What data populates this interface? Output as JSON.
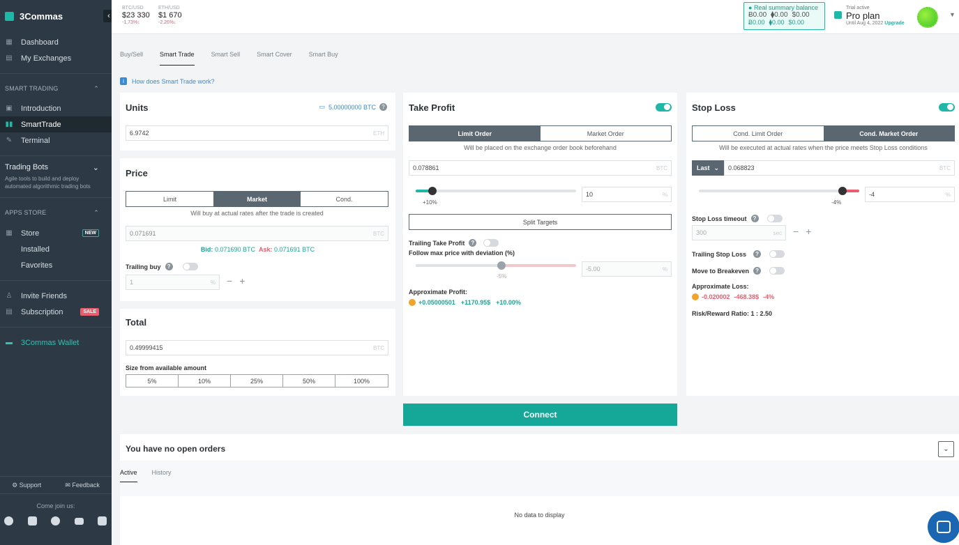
{
  "app": {
    "name": "3Commas"
  },
  "sidebar": {
    "main": [
      {
        "label": "Dashboard"
      },
      {
        "label": "My Exchanges"
      }
    ],
    "smart_trading_title": "SMART TRADING",
    "smart_trading": [
      {
        "label": "Introduction"
      },
      {
        "label": "SmartTrade"
      },
      {
        "label": "Terminal"
      }
    ],
    "trading_bots_title": "Trading Bots",
    "trading_bots_desc": "Agile tools to build and deploy automated algorithmic trading bots",
    "apps_store_title": "APPS STORE",
    "apps_store": [
      {
        "label": "Store",
        "badge": "NEW"
      },
      {
        "label": "Installed"
      },
      {
        "label": "Favorites"
      }
    ],
    "invite": "Invite Friends",
    "subscription": "Subscription",
    "subscription_badge": "SALE",
    "wallet": "3Commas Wallet",
    "support": "Support",
    "feedback": "Feedback",
    "join": "Come join us:",
    "socials": [
      "facebook-icon",
      "twitter-icon",
      "telegram-icon",
      "youtube-icon",
      "discord-icon"
    ]
  },
  "topbar": {
    "tickers": [
      {
        "pair": "BTC/USD",
        "price": "$23 330",
        "change": "-1.73%↓"
      },
      {
        "pair": "ETH/USD",
        "price": "$1 670",
        "change": "-2.26%↓"
      }
    ],
    "summary": {
      "title": "Real summary balance",
      "row1": [
        "Ƀ0.00",
        "⧫0.00",
        "$0.00"
      ],
      "row2": [
        "Ƀ0.00",
        "⧫0.00",
        "$0.00"
      ]
    },
    "plan": {
      "status": "Trial active",
      "name": "Pro plan",
      "until": "Until Aug 4, 2022",
      "upgrade": "Upgrade"
    }
  },
  "tabs": [
    "Buy/Sell",
    "Smart Trade",
    "Smart Sell",
    "Smart Cover",
    "Smart Buy"
  ],
  "howto": "How does Smart Trade work?",
  "units": {
    "title": "Units",
    "balance": "5.00000000 BTC",
    "value": "6.9742",
    "unit": "ETH"
  },
  "price": {
    "title": "Price",
    "modes": [
      "Limit",
      "Market",
      "Cond."
    ],
    "note": "Will buy at actual rates after the trade is created",
    "value": "0.071691",
    "unit": "BTC",
    "bid_label": "Bid:",
    "bid": "0.071690 BTC",
    "ask_label": "Ask:",
    "ask": "0.071691 BTC",
    "trailing_label": "Trailing buy",
    "trailing_value": "1",
    "trailing_unit": "%"
  },
  "total": {
    "title": "Total",
    "value": "0.49999415",
    "unit": "BTC",
    "size_label": "Size from available amount",
    "sizes": [
      "5%",
      "10%",
      "25%",
      "50%",
      "100%"
    ]
  },
  "take_profit": {
    "title": "Take Profit",
    "modes": [
      "Limit Order",
      "Market Order"
    ],
    "note": "Will be placed on the exchange order book beforehand",
    "value": "0.078861",
    "unit": "BTC",
    "slider_label": "+10%",
    "slider_level": 0.1,
    "percent_value": "10",
    "percent_unit": "%",
    "split": "Split Targets",
    "trailing_label": "Trailing Take Profit",
    "follow_label": "Follow max price with deviation (%)",
    "deviation_label": "-5%",
    "deviation_value": "-5.00",
    "deviation_unit": "%",
    "approx_label": "Approximate Profit:",
    "approx": [
      "+0.05000501",
      "+1170.95$",
      "+10.00%"
    ]
  },
  "stop_loss": {
    "title": "Stop Loss",
    "modes": [
      "Cond. Limit Order",
      "Cond. Market Order"
    ],
    "note": "Will be executed at actual rates when the price meets Stop Loss conditions",
    "last": "Last",
    "value": "0.068823",
    "unit": "BTC",
    "slider_label": "-4%",
    "percent_value": "-4",
    "percent_unit": "%",
    "timeout_label": "Stop Loss timeout",
    "timeout_value": "300",
    "timeout_unit": "sec",
    "trailing_label": "Trailing Stop Loss",
    "breakeven_label": "Move to Breakeven",
    "approx_label": "Approximate Loss:",
    "approx": [
      "-0.020002",
      "-468.38$",
      "-4%"
    ],
    "ratio": "Risk/Reward Ratio: 1 : 2.50"
  },
  "connect": "Connect",
  "orders": {
    "title": "You have no open orders",
    "tabs": [
      "Active",
      "History"
    ],
    "empty": "No data to display"
  },
  "colors": {
    "accent": "#1fb7a6",
    "sidebar": "#2d3a45",
    "negative": "#e95d6e",
    "positive": "#15a898"
  }
}
